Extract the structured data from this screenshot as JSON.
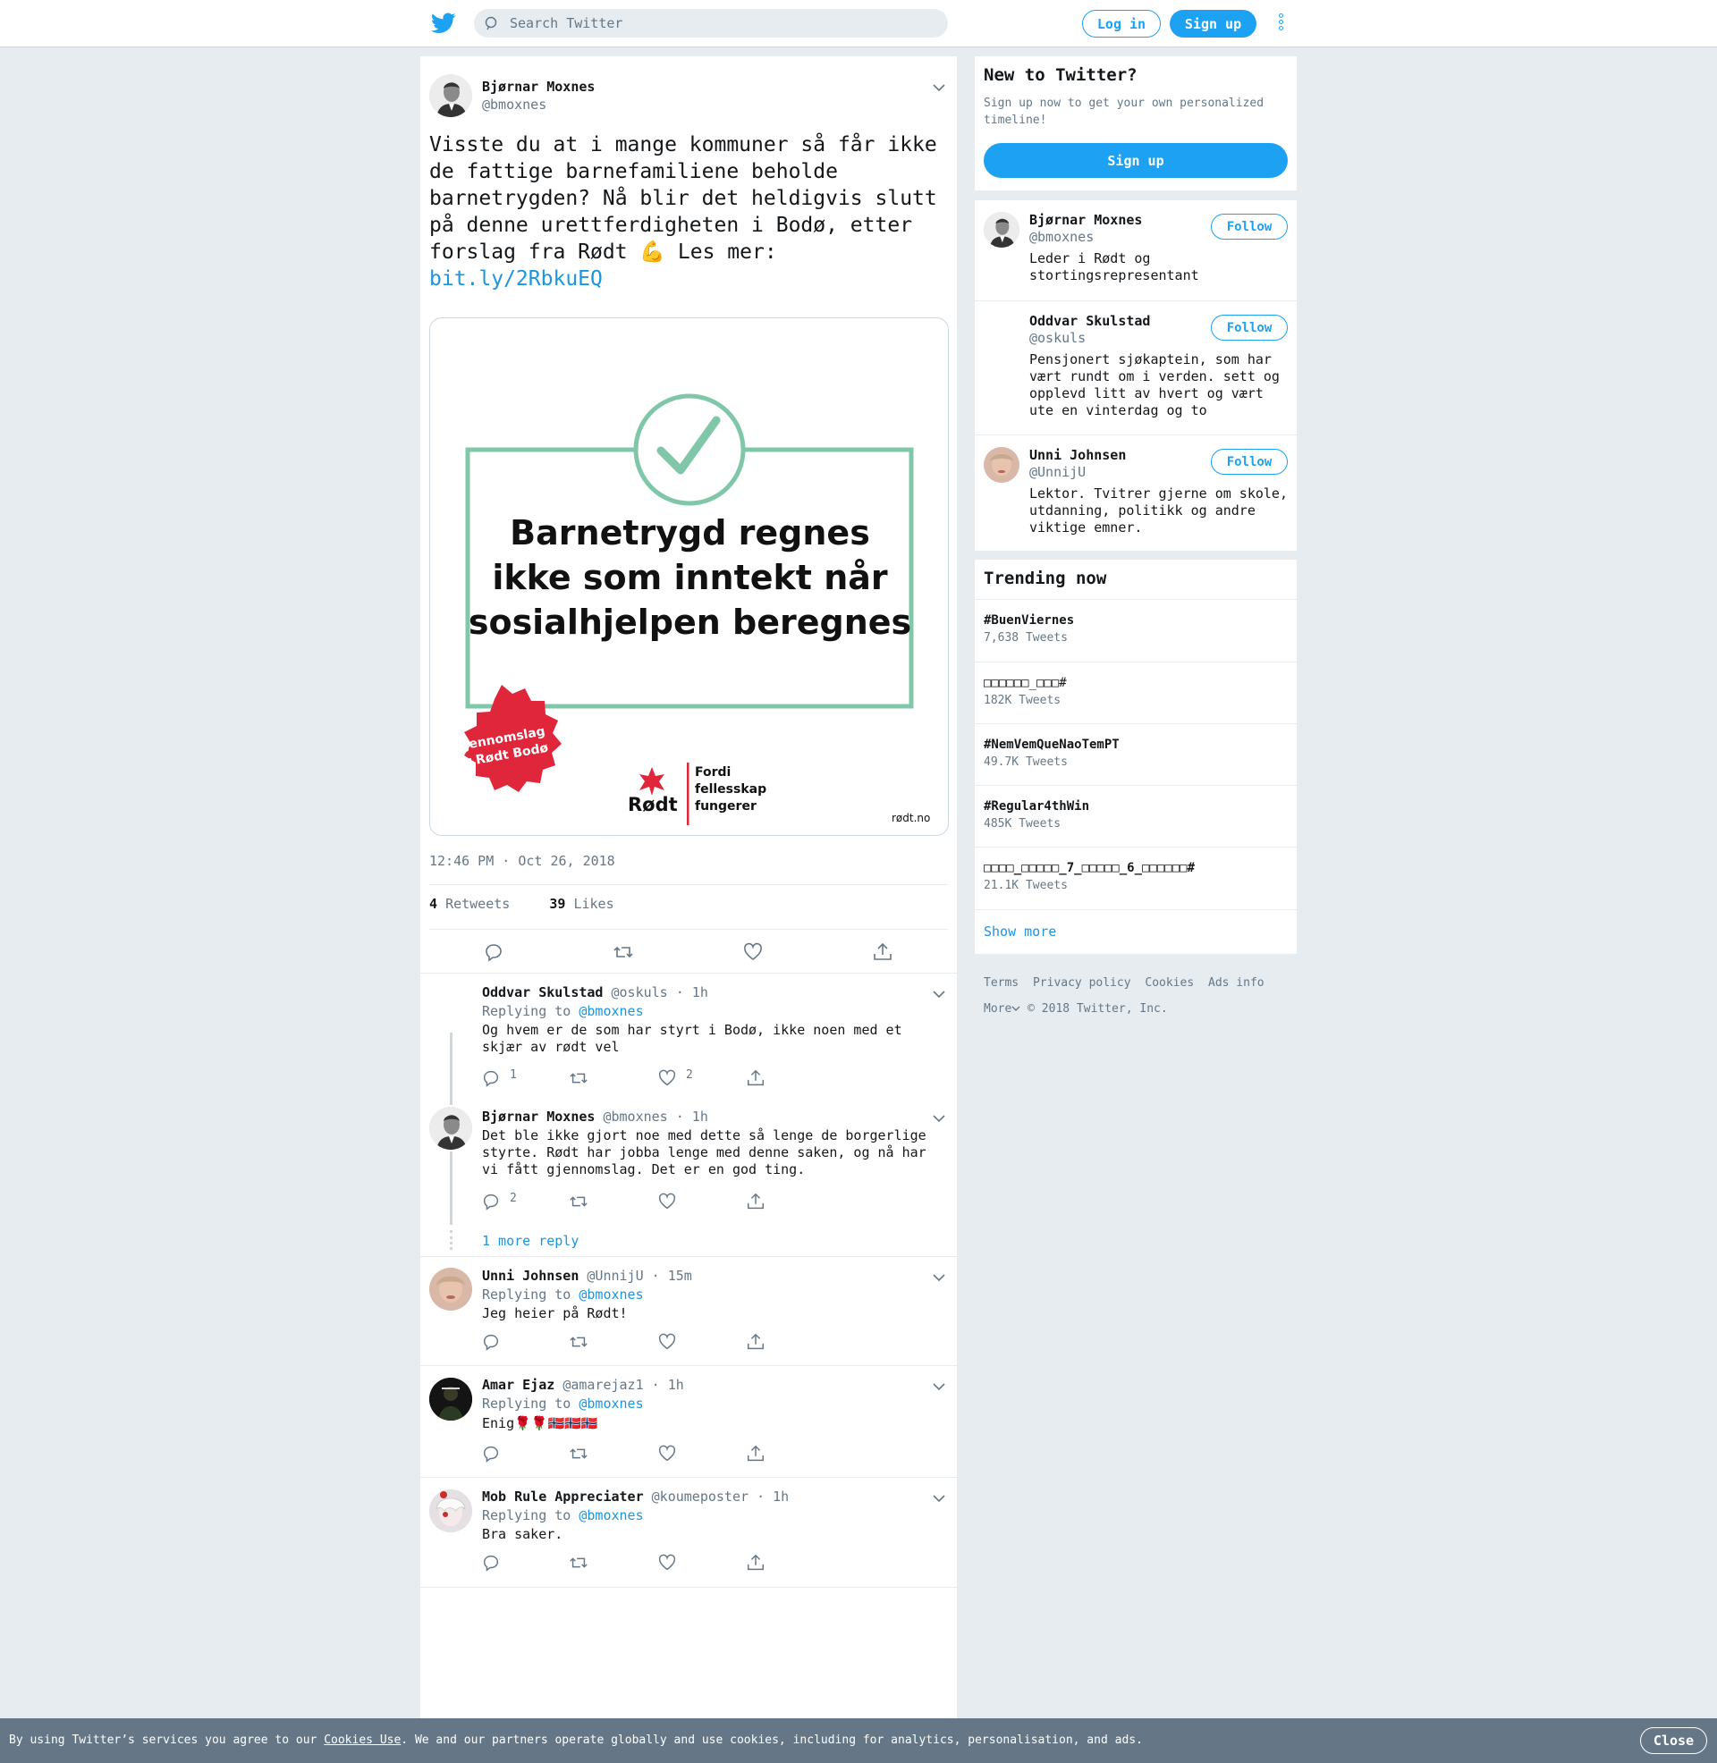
{
  "header": {
    "search_placeholder": "Search Twitter",
    "login_label": "Log in",
    "signup_label": "Sign up"
  },
  "tweet": {
    "author_name": "Bjørnar Moxnes",
    "author_handle": "@bmoxnes",
    "text": "Visste du at i mange kommuner så får ikke de fattige barnefamiliene beholde barnetrygden? Nå blir det heldigvis slutt på denne urettferdigheten i Bodø, etter forslag fra Rødt 💪 Les mer:",
    "link": "bit.ly/2RbkuEQ",
    "card": {
      "headline_1": "Barnetrygd regnes",
      "headline_2": "ikke som inntekt når",
      "headline_3": "sosialhjelpen beregnes",
      "badge_line_1": "Gjennomslag",
      "badge_line_2": "for Rødt Bodø",
      "party": "Rødt",
      "slogan_1": "Fordi",
      "slogan_2": "fellesskap",
      "slogan_3": "fungerer",
      "site": "rødt.no"
    },
    "timestamp": "12:46 PM · Oct 26, 2018",
    "retweets_count": "4",
    "retweets_label": "Retweets",
    "likes_count": "39",
    "likes_label": "Likes"
  },
  "replies": [
    {
      "name": "Oddvar Skulstad",
      "handle": "@oskuls",
      "time": "· 1h",
      "replying": "Replying to",
      "to": "@bmoxnes",
      "text_1": "Og hvem er de som har styrt i Bodø, ikke noen med et",
      "text_2": "skjær av rødt vel",
      "reply_count": "1",
      "like_count": "2"
    },
    {
      "name": "Bjørnar Moxnes",
      "handle": "@bmoxnes",
      "time": "· 1h",
      "text_1": "Det ble ikke gjort noe med dette så lenge de borgerlige",
      "text_2": "styrte. Rødt har jobba lenge med denne saken, og nå har",
      "text_3": "vi fått gjennomslag. Det er en god ting.",
      "reply_count": "2"
    },
    {
      "name": "Unni Johnsen",
      "handle": "@UnnijU",
      "time": "· 15m",
      "replying": "Replying to",
      "to": "@bmoxnes",
      "text_1": "Jeg heier på Rødt!"
    },
    {
      "name": "Amar Ejaz",
      "handle": "@amarejaz1",
      "time": "· 1h",
      "replying": "Replying to",
      "to": "@bmoxnes",
      "text_1": "Enig🌹🌹🇳🇴🇳🇴🇳🇴"
    },
    {
      "name": "Mob Rule Appreciater",
      "handle": "@koumeposter",
      "time": "· 1h",
      "replying": "Replying to",
      "to": "@bmoxnes",
      "text_1": "Bra saker."
    }
  ],
  "more_replies": "1 more reply",
  "sidebar": {
    "new_title": "New to Twitter?",
    "new_sub_1": "Sign up now to get your own personalized",
    "new_sub_2": "timeline!",
    "signup_label": "Sign up",
    "follow_label": "Follow",
    "who_to_follow": [
      {
        "name": "Bjørnar Moxnes",
        "handle": "@bmoxnes",
        "bio_1": "Leder i Rødt og",
        "bio_2": "stortingsrepresentant"
      },
      {
        "name": "Oddvar Skulstad",
        "handle": "@oskuls",
        "bio_1": "Pensjonert sjøkaptein, som har",
        "bio_2": "vært rundt om i verden. sett og",
        "bio_3": "opplevd litt av hvert og vært",
        "bio_4": "ute en vinterdag og to"
      },
      {
        "name": "Unni Johnsen",
        "handle": "@UnnijU",
        "bio_1": "Lektor. Tvitrer gjerne om skole,",
        "bio_2": "utdanning, politikk og andre",
        "bio_3": "viktige emner."
      }
    ],
    "trending_title": "Trending now",
    "trends": [
      {
        "name": "#BuenViernes",
        "count": "7,638 Tweets"
      },
      {
        "name": "□□□□□□_□□□#",
        "count": "182K Tweets"
      },
      {
        "name": "#NemVemQueNaoTemPT",
        "count": "49.7K Tweets"
      },
      {
        "name": "#Regular4thWin",
        "count": "485K Tweets"
      },
      {
        "name": "□□□□_□□□□□_7_□□□□□_6_□□□□□□#",
        "count": "21.1K Tweets"
      }
    ],
    "show_more": "Show more"
  },
  "footer": {
    "terms": "Terms",
    "privacy": "Privacy policy",
    "cookies": "Cookies",
    "ads": "Ads info",
    "more": "More",
    "copyright": "© 2018 Twitter, Inc."
  },
  "cookie_bar": {
    "pre": "By using Twitter’s services you agree to our ",
    "link": "Cookies Use",
    "post": ". We and our partners operate globally and use cookies, including for analytics, personalisation, and ads.",
    "close": "Close"
  },
  "colors": {
    "accent": "#1da1f2",
    "link": "#1b95e0",
    "background": "#e6ecf0",
    "card_green": "#7fc7a8",
    "party_red": "#e0263a"
  }
}
